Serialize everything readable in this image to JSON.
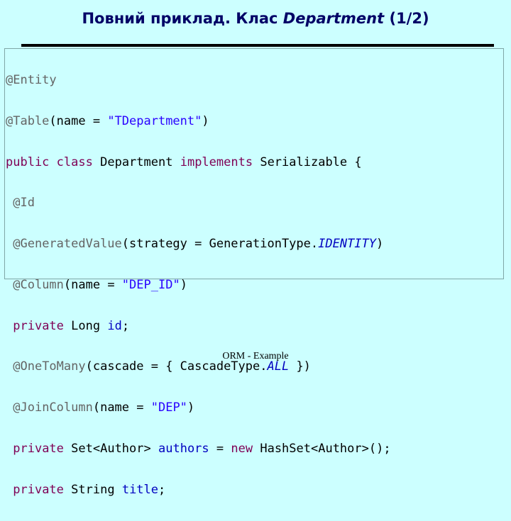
{
  "title": {
    "prefix": "Повний приклад. Клас ",
    "emphasis": "Department",
    "suffix": " (1/2)"
  },
  "code_tokens": {
    "entity": "@Entity",
    "table": "@Table",
    "table_args_open": "(name = ",
    "table_name": "\"TDepartment\"",
    "close_paren": ")",
    "public": "public",
    "class": "class",
    "class_name": "Department",
    "implements": "implements",
    "serializable": "Serializable {",
    "id_ann": "@Id",
    "gen_ann": "@GeneratedValue",
    "gen_args": "(strategy = GenerationType.",
    "identity": "IDENTITY",
    "column_ann": "@Column",
    "col_name": "\"DEP_ID\"",
    "private": "private",
    "long_type": "Long",
    "id_field": "id",
    "semicolon": ";",
    "onetomany_ann": "@OneToMany",
    "cascade_args": "(cascade = { CascadeType.",
    "all": "ALL",
    "cascade_close": " })",
    "joincolumn_ann": "@JoinColumn",
    "join_name": "\"DEP\"",
    "set_type": "Set<Author>",
    "authors_field": "authors",
    "equals": " = ",
    "new": "new",
    "hashset": "HashSet<Author>();",
    "string_type": "String",
    "title_field": "title"
  },
  "footer": "ORM - Example"
}
